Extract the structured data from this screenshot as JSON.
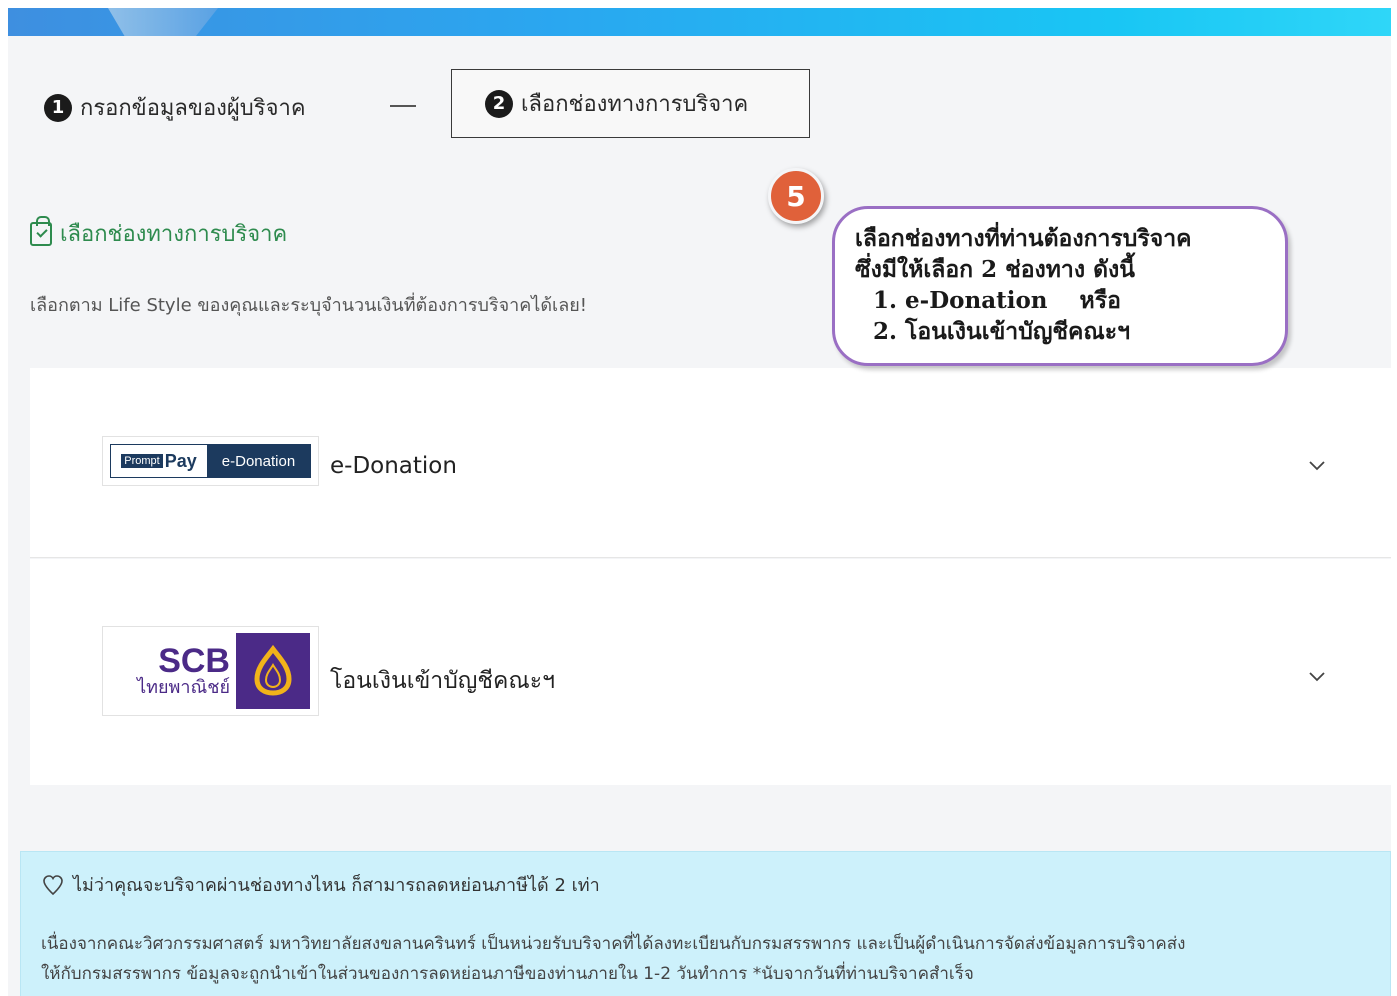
{
  "steps": [
    {
      "number": "1",
      "label": "กรอกข้อมูลของผู้บริจาค"
    },
    {
      "number": "2",
      "label": "เลือกช่องทางการบริจาค"
    }
  ],
  "callout": {
    "badge": "5",
    "line1": "เลือกช่องทางที่ท่านต้องการบริจาค",
    "line2": "ซึ่งมีให้เลือก 2 ช่องทาง ดังนี้",
    "item1": "1. e-Donation    หรือ",
    "item2": "2. โอนเงินเข้าบัญชีคณะฯ"
  },
  "section": {
    "title": "เลือกช่องทางการบริจาค",
    "description": "เลือกตาม Life Style ของคุณและระบุจำนวนเงินที่ต้องการบริจาคได้เลย!"
  },
  "options": [
    {
      "label": "e-Donation",
      "logo_left_prompt": "Prompt",
      "logo_left_pay": "Pay",
      "logo_right": "e-Donation"
    },
    {
      "label": "โอนเงินเข้าบัญชีคณะฯ",
      "logo_big": "SCB",
      "logo_thai": "ไทยพาณิชย์"
    }
  ],
  "info": {
    "heading": "ไม่ว่าคุณจะบริจาคผ่านช่องทางไหน ก็สามารถลดหย่อนภาษีได้ 2 เท่า",
    "body_line1": "เนื่องจากคณะวิศวกรรมศาสตร์ มหาวิทยาลัยสงขลานครินทร์ เป็นหน่วยรับบริจาคที่ได้ลงทะเบียนกับกรมสรรพากร และเป็นผู้ดำเนินการจัดส่งข้อมูลการบริจาคส่ง",
    "body_line2": "ให้กับกรมสรรพากร ข้อมูลจะถูกนำเข้าในส่วนของการลดหย่อนภาษีของท่านภายใน 1-2 วันทำการ *นับจากวันที่ท่านบริจาคสำเร็จ"
  },
  "colors": {
    "accent_green": "#2e8b4e",
    "callout_border": "#9a6fc4",
    "badge": "#e0613a",
    "info_bg": "#cdf1fb",
    "scb_purple": "#4b2a87"
  }
}
